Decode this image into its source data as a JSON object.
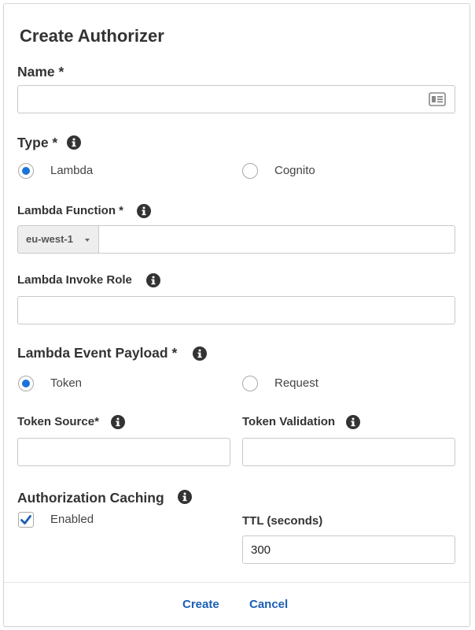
{
  "dialog": {
    "title": "Create Authorizer"
  },
  "name": {
    "label": "Name *",
    "value": ""
  },
  "type": {
    "label": "Type *",
    "options": [
      "Lambda",
      "Cognito"
    ],
    "selected": "Lambda"
  },
  "lambda_function": {
    "label": "Lambda Function *",
    "region": "eu-west-1",
    "value": ""
  },
  "lambda_invoke_role": {
    "label": "Lambda Invoke Role",
    "value": ""
  },
  "event_payload": {
    "label": "Lambda Event Payload *",
    "options": [
      "Token",
      "Request"
    ],
    "selected": "Token"
  },
  "token_source": {
    "label": "Token Source*",
    "value": ""
  },
  "token_validation": {
    "label": "Token Validation",
    "value": ""
  },
  "caching": {
    "label": "Authorization Caching",
    "enabled_label": "Enabled",
    "enabled": true,
    "ttl_label": "TTL (seconds)",
    "ttl_value": "300"
  },
  "footer": {
    "create_label": "Create",
    "cancel_label": "Cancel"
  },
  "colors": {
    "accent": "#1a73d9",
    "link": "#1a5fb4",
    "info_icon": "#333333"
  },
  "icons": {
    "info": "info-icon",
    "contact_card": "contact-card-icon",
    "check": "checkmark-icon"
  }
}
